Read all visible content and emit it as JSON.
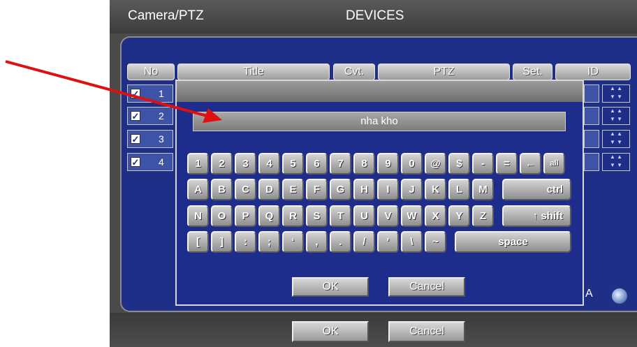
{
  "window": {
    "left_title": "Camera/PTZ",
    "center_title": "DEVICES"
  },
  "table": {
    "headers": [
      "No",
      "Title",
      "Cvt.",
      "PTZ",
      "Set.",
      "ID"
    ],
    "rows": [
      {
        "no": "1",
        "checked": true
      },
      {
        "no": "2",
        "checked": true
      },
      {
        "no": "3",
        "checked": true
      },
      {
        "no": "4",
        "checked": true
      }
    ]
  },
  "keyboard": {
    "text_value": "nha kho",
    "row1": [
      "1",
      "2",
      "3",
      "4",
      "5",
      "6",
      "7",
      "8",
      "9",
      "0",
      "@",
      "$",
      "-",
      "=",
      "←",
      "all"
    ],
    "row2": [
      "A",
      "B",
      "C",
      "D",
      "E",
      "F",
      "G",
      "H",
      "I",
      "J",
      "K",
      "L",
      "M"
    ],
    "row2_wide": "ctrl",
    "row3": [
      "N",
      "O",
      "P",
      "Q",
      "R",
      "S",
      "T",
      "U",
      "V",
      "W",
      "X",
      "Y",
      "Z"
    ],
    "row3_wide": "↑ shift",
    "row4": [
      "[",
      "]",
      ":",
      ";",
      "‘",
      ",",
      ".",
      "/",
      "’",
      "\\",
      "~"
    ],
    "row4_wide": "space",
    "ok_label": "OK",
    "cancel_label": "Cancel"
  },
  "partial_right_label": "A",
  "footer": {
    "ok_label": "OK",
    "cancel_label": "Cancel"
  },
  "colors": {
    "panel": "#1f2e86",
    "annotation_arrow": "#e01010"
  }
}
